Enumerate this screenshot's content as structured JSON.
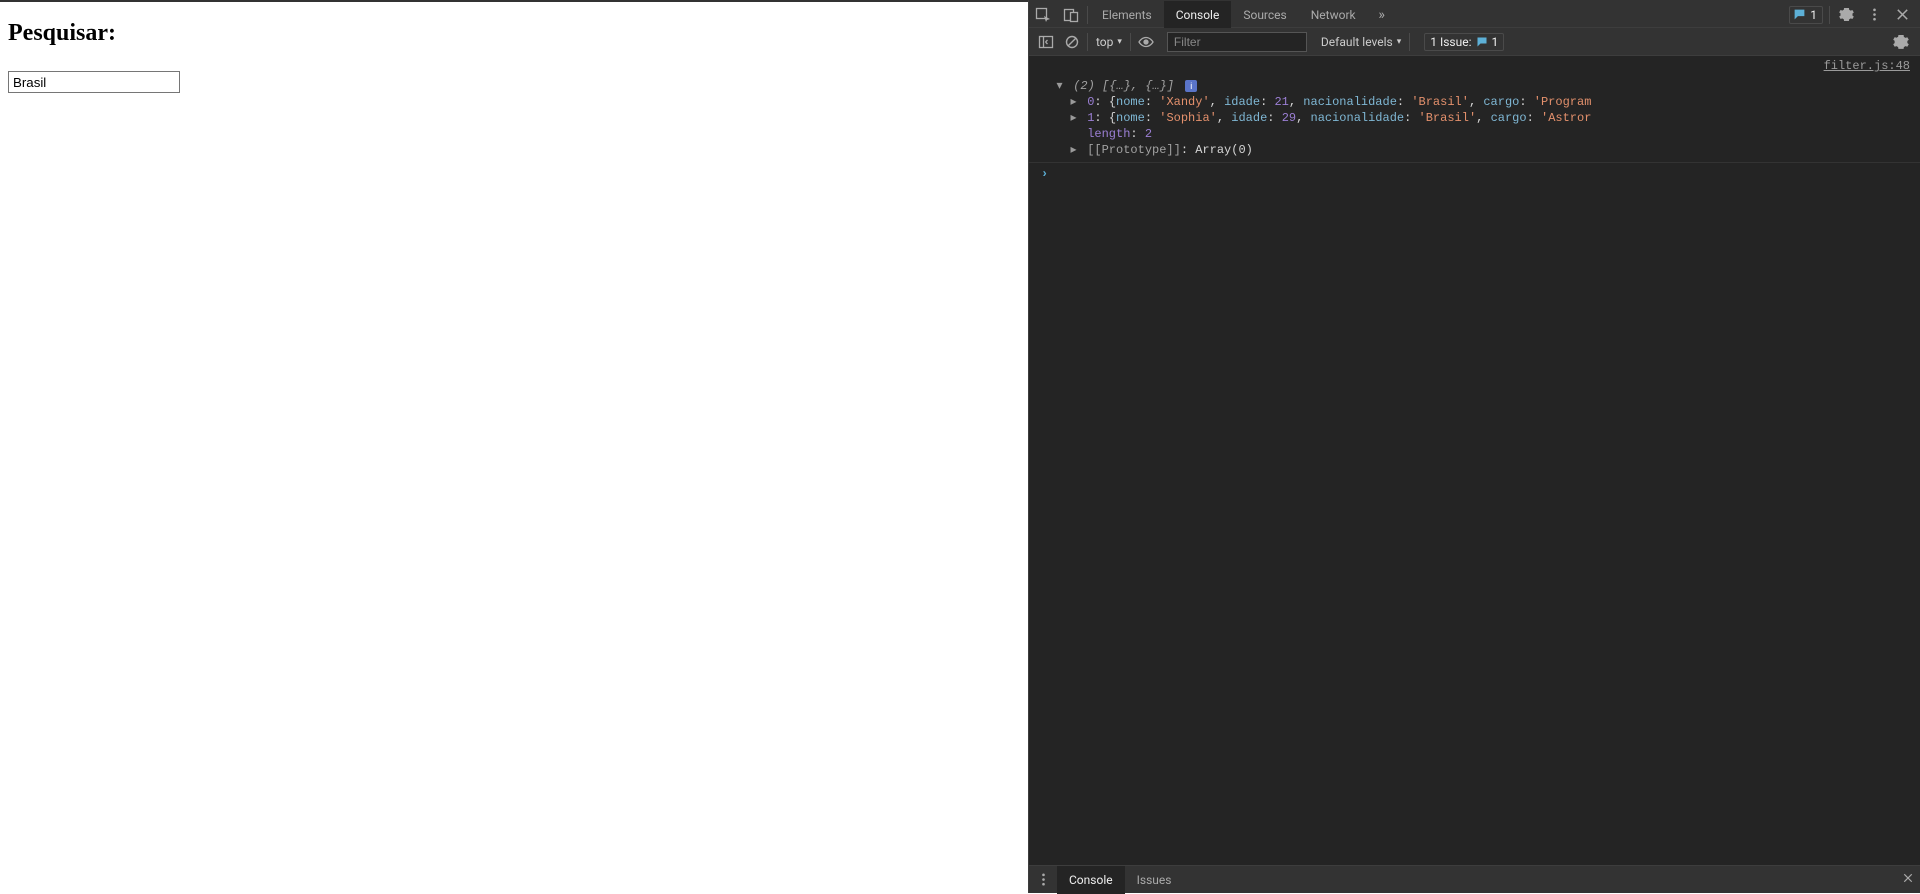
{
  "page": {
    "heading": "Pesquisar:",
    "search_value": "Brasil"
  },
  "devtools": {
    "tabs": {
      "elements": "Elements",
      "console": "Console",
      "sources": "Sources",
      "network": "Network",
      "more_glyph": "»"
    },
    "issues_count_top": "1",
    "subbar": {
      "context_label": "top",
      "filter_placeholder": "Filter",
      "levels_label": "Default levels",
      "issues_label": "1 Issue:",
      "issues_count": "1"
    },
    "source_link": "filter.js:48",
    "console": {
      "arr_summary_prefix": "(2)",
      "arr_summary_body": " [{…}, {…}]",
      "info_badge": "i",
      "items": [
        {
          "index": "0",
          "nome": "Xandy",
          "idade": "21",
          "nacionalidade": "Brasil",
          "cargo_prefix": "Program"
        },
        {
          "index": "1",
          "nome": "Sophia",
          "idade": "29",
          "nacionalidade": "Brasil",
          "cargo_prefix": "Astror"
        }
      ],
      "length_key": "length",
      "length_val": "2",
      "prototype_label": "[[Prototype]]",
      "prototype_val": "Array(0)"
    },
    "drawer": {
      "console": "Console",
      "issues": "Issues"
    }
  }
}
